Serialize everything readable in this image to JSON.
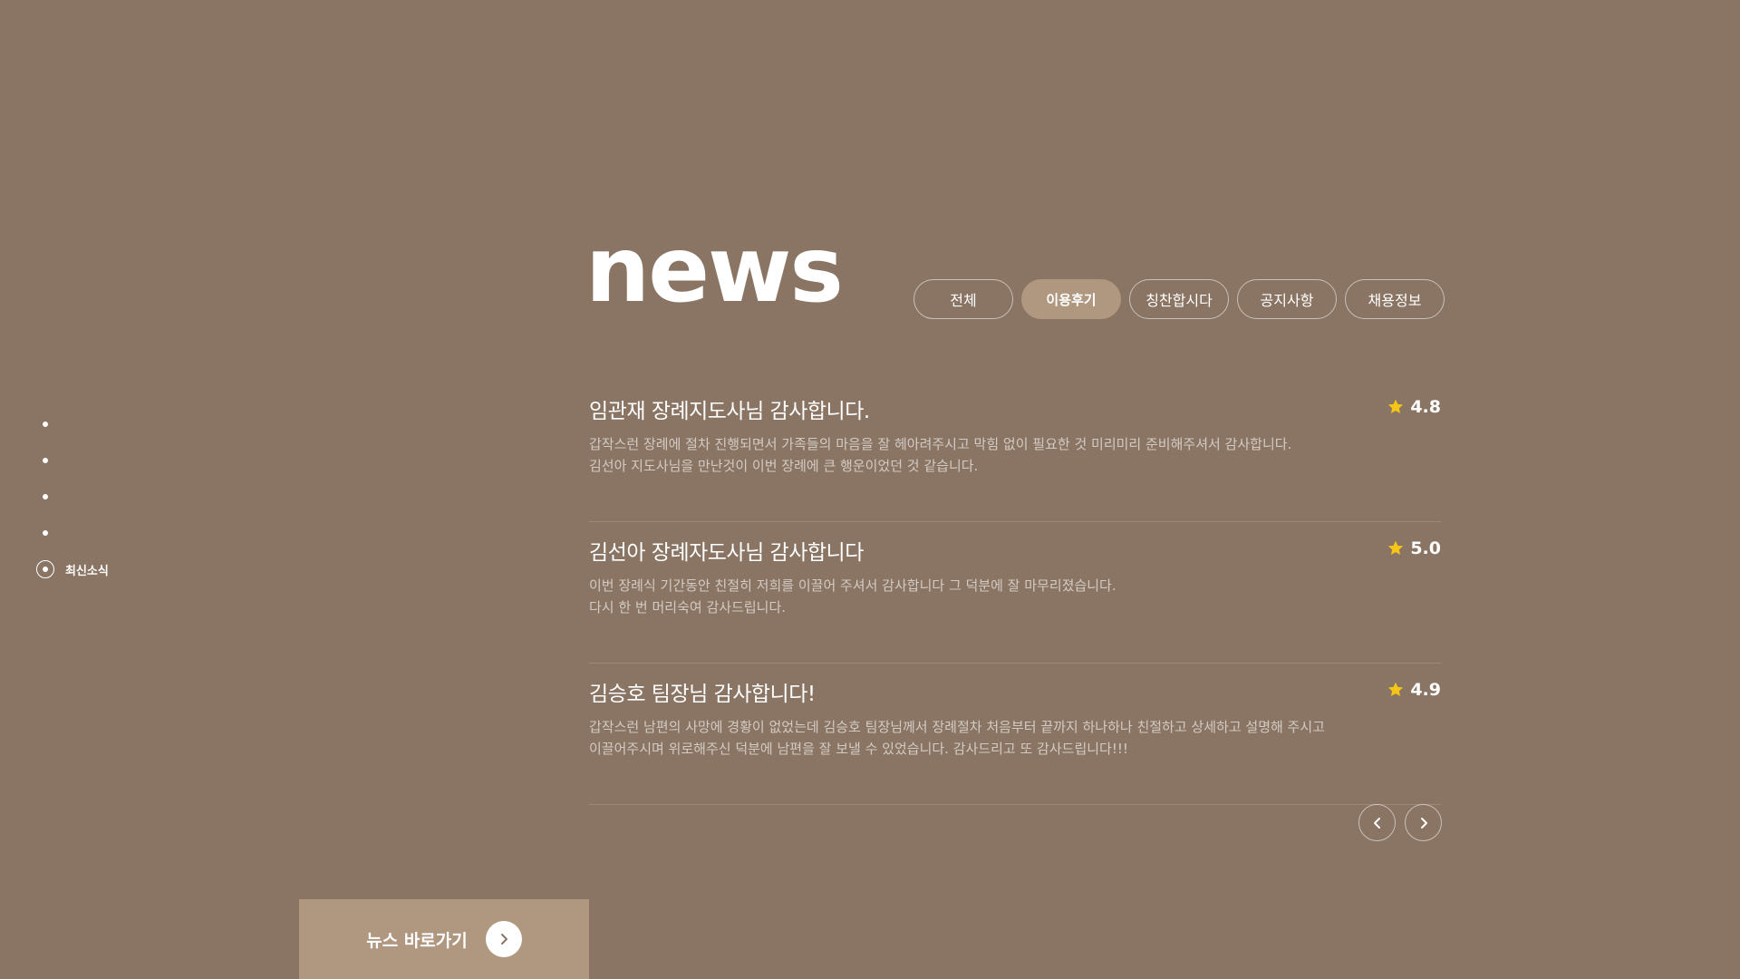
{
  "side_nav": {
    "items": [
      "",
      "",
      "",
      ""
    ],
    "active_label": "최신소식"
  },
  "header": {
    "title": "news"
  },
  "tabs": [
    {
      "label": "전체"
    },
    {
      "label": "이용후기"
    },
    {
      "label": "칭찬합시다"
    },
    {
      "label": "공지사항"
    },
    {
      "label": "채용정보"
    }
  ],
  "active_tab": "이용후기",
  "colors": {
    "background": "#8a7463",
    "accent": "#b09780",
    "star": "#f5c518"
  },
  "news": [
    {
      "title": "임관재 장례지도사님 감사합니다.",
      "rating": "4.8",
      "desc_line1": "갑작스런 장례에 절차 진행되면서 가족들의 마음을 잘 헤아려주시고 막힘 없이 필요한 것 미리미리 준비해주셔서 감사합니다.",
      "desc_line2": "김선아 지도사님을 만난것이 이번 장례에 큰 행운이었던 것 같습니다."
    },
    {
      "title": "김선아 장례자도사님 감사합니다",
      "rating": "5.0",
      "desc_line1": "이번 장례식 기간동안 친절히 저희를 이끌어 주셔서 감사합니다 그 덕분에 잘 마무리졌습니다.",
      "desc_line2": "다시 한 번 머리숙여 감사드립니다."
    },
    {
      "title": "김승호 팀장님 감사합니다!",
      "rating": "4.9",
      "desc_line1": "갑작스런 남편의 사망에 경황이 없었는데 김승호 팀장님께서 장례절차 처음부터 끝까지 하나하나 친절하고 상세하고 설명해 주시고",
      "desc_line2": "이끌어주시며 위로해주신 덕분에 남편을 잘 보낼 수 있었습니다. 감사드리고 또 감사드립니다!!!"
    }
  ],
  "cta": {
    "label": "뉴스 바로가기",
    "icon": "chevron-right-icon"
  },
  "pager": {
    "prev_icon": "chevron-left-icon",
    "next_icon": "chevron-right-icon"
  }
}
